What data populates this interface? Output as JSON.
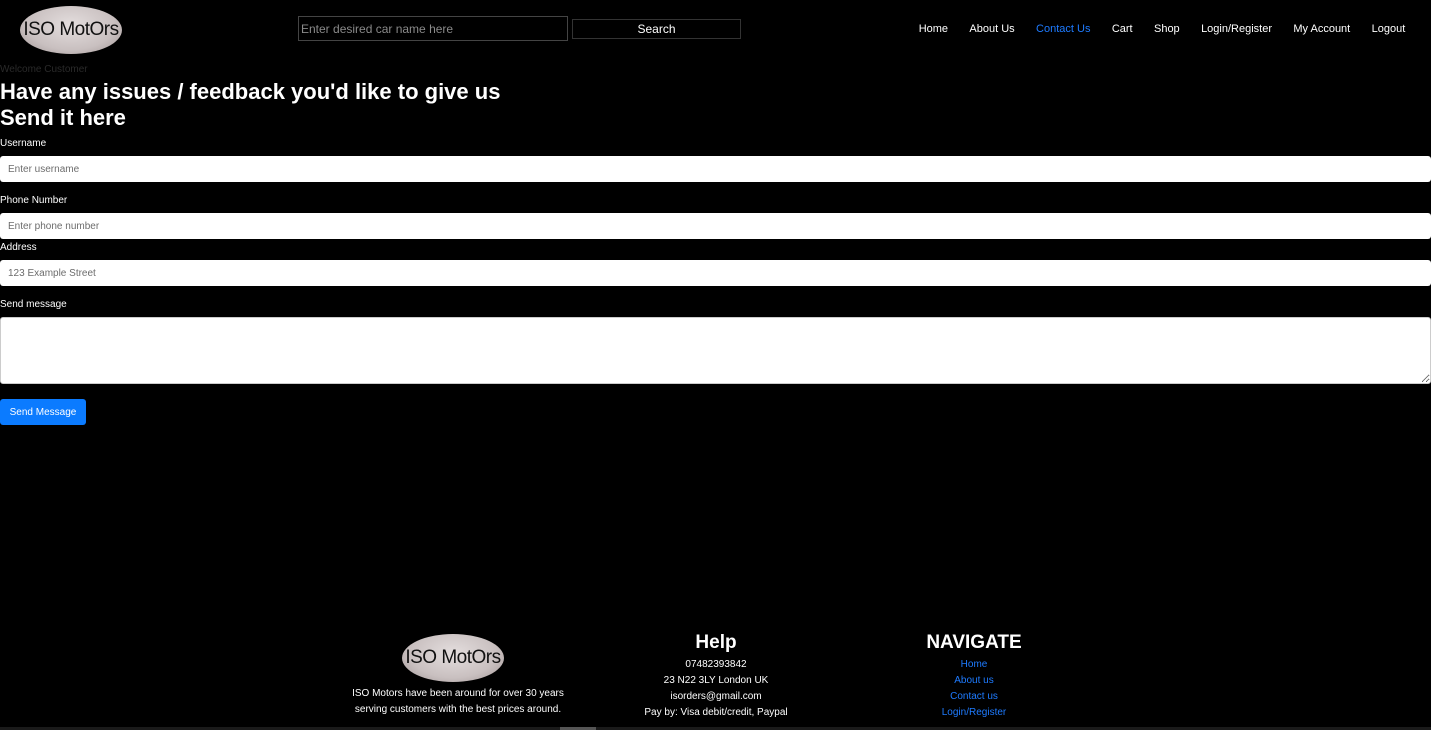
{
  "header": {
    "logo_text": "ISO MotOrs",
    "search_placeholder": "Enter desired car name here",
    "search_button": "Search",
    "nav": [
      "Home",
      "About Us",
      "Contact Us",
      "Cart",
      "Shop",
      "Login/Register",
      "My Account",
      "Logout"
    ],
    "active_nav": "Contact Us"
  },
  "main": {
    "welcome": "Welcome Customer",
    "heading_line1": "Have any issues / feedback you'd like to give us",
    "heading_line2": "Send it here",
    "username_label": "Username",
    "username_placeholder": "Enter username",
    "phone_label": "Phone Number",
    "phone_placeholder": "Enter phone number",
    "address_label": "Address",
    "address_placeholder": "123 Example Street",
    "message_label": "Send message",
    "message_value": "",
    "send_button": "Send Message"
  },
  "footer": {
    "logo_text": "ISO MotOrs",
    "about_line1": "ISO Motors have been around for over 30 years",
    "about_line2": "serving customers with the best prices around.",
    "help_title": "Help",
    "help_phone": "07482393842",
    "help_address": "23 N22 3LY London UK",
    "help_email": "isorders@gmail.com",
    "help_pay": "Pay by: Visa debit/credit, Paypal",
    "navigate_title": "NAVIGATE",
    "nav_links": [
      "Home",
      "About us",
      "Contact us",
      "Login/Register"
    ]
  },
  "colors": {
    "background": "#000000",
    "accent": "#0b7bff",
    "link": "#1e7bff"
  }
}
